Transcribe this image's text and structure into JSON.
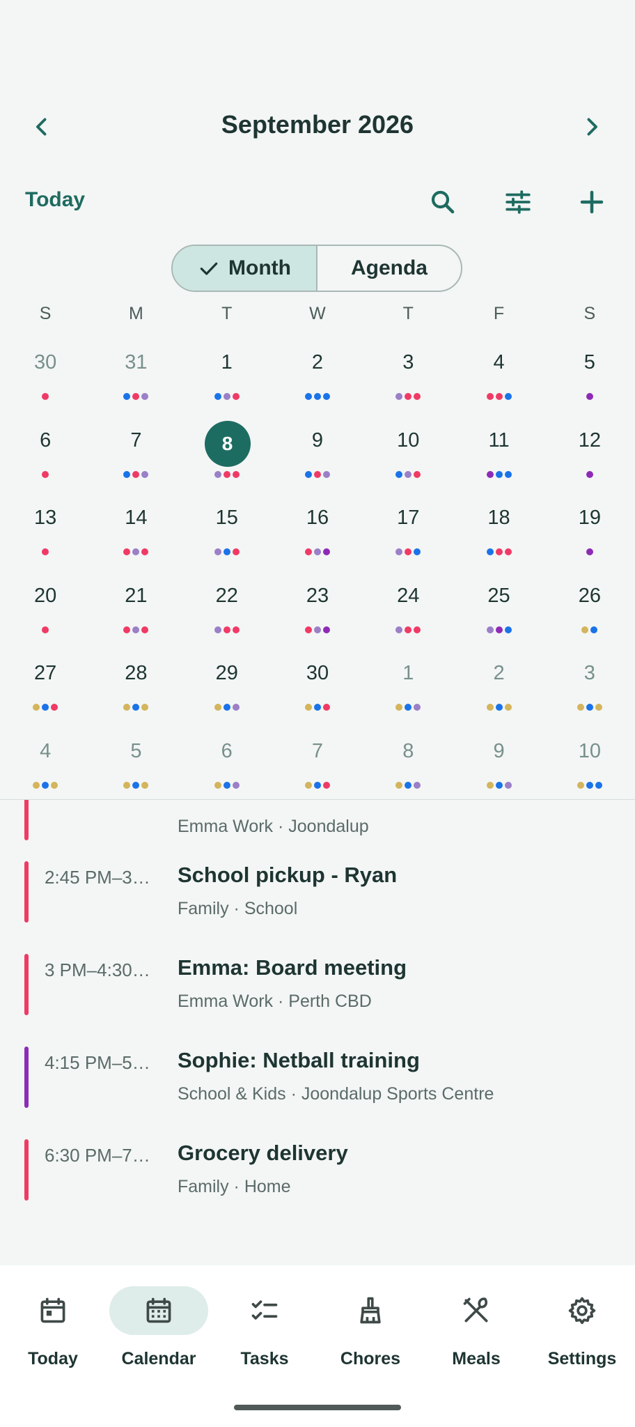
{
  "header": {
    "title": "September 2026",
    "prev_icon": "chevron-left-icon",
    "next_icon": "chevron-right-icon"
  },
  "toolbar": {
    "today_label": "Today",
    "icons": [
      "search-icon",
      "tune-icon",
      "add-icon"
    ]
  },
  "view_toggle": {
    "month_label": "Month",
    "agenda_label": "Agenda",
    "selected": "Month"
  },
  "weekdays": [
    "S",
    "M",
    "T",
    "W",
    "T",
    "F",
    "S"
  ],
  "colors": {
    "red": "#f03a66",
    "blue": "#1a73e8",
    "lavender": "#9b7fc7",
    "purple": "#8e2bb6",
    "gold": "#d4b45c",
    "accent": "#1d6c62"
  },
  "calendar": {
    "selected_day": "8",
    "weeks": [
      [
        {
          "d": "30",
          "o": true,
          "dots": [
            "red"
          ]
        },
        {
          "d": "31",
          "o": true,
          "dots": [
            "blue",
            "red",
            "lavender"
          ]
        },
        {
          "d": "1",
          "dots": [
            "blue",
            "lavender",
            "red"
          ]
        },
        {
          "d": "2",
          "dots": [
            "blue",
            "blue",
            "blue"
          ]
        },
        {
          "d": "3",
          "dots": [
            "lavender",
            "red",
            "red"
          ]
        },
        {
          "d": "4",
          "dots": [
            "red",
            "red",
            "blue"
          ]
        },
        {
          "d": "5",
          "dots": [
            "purple"
          ]
        }
      ],
      [
        {
          "d": "6",
          "dots": [
            "red"
          ]
        },
        {
          "d": "7",
          "dots": [
            "blue",
            "red",
            "lavender"
          ]
        },
        {
          "d": "8",
          "sel": true,
          "dots": [
            "lavender",
            "red",
            "red"
          ]
        },
        {
          "d": "9",
          "dots": [
            "blue",
            "red",
            "lavender"
          ]
        },
        {
          "d": "10",
          "dots": [
            "blue",
            "lavender",
            "red"
          ]
        },
        {
          "d": "11",
          "dots": [
            "purple",
            "blue",
            "blue"
          ]
        },
        {
          "d": "12",
          "dots": [
            "purple"
          ]
        }
      ],
      [
        {
          "d": "13",
          "dots": [
            "red"
          ]
        },
        {
          "d": "14",
          "dots": [
            "red",
            "lavender",
            "red"
          ]
        },
        {
          "d": "15",
          "dots": [
            "lavender",
            "blue",
            "red"
          ]
        },
        {
          "d": "16",
          "dots": [
            "red",
            "lavender",
            "purple"
          ]
        },
        {
          "d": "17",
          "dots": [
            "lavender",
            "red",
            "blue"
          ]
        },
        {
          "d": "18",
          "dots": [
            "blue",
            "red",
            "red"
          ]
        },
        {
          "d": "19",
          "dots": [
            "purple"
          ]
        }
      ],
      [
        {
          "d": "20",
          "dots": [
            "red"
          ]
        },
        {
          "d": "21",
          "dots": [
            "red",
            "lavender",
            "red"
          ]
        },
        {
          "d": "22",
          "dots": [
            "lavender",
            "red",
            "red"
          ]
        },
        {
          "d": "23",
          "dots": [
            "red",
            "lavender",
            "purple"
          ]
        },
        {
          "d": "24",
          "dots": [
            "lavender",
            "red",
            "red"
          ]
        },
        {
          "d": "25",
          "dots": [
            "lavender",
            "purple",
            "blue"
          ]
        },
        {
          "d": "26",
          "dots": [
            "gold",
            "blue"
          ]
        }
      ],
      [
        {
          "d": "27",
          "dots": [
            "gold",
            "blue",
            "red"
          ]
        },
        {
          "d": "28",
          "dots": [
            "gold",
            "blue",
            "gold"
          ]
        },
        {
          "d": "29",
          "dots": [
            "gold",
            "blue",
            "lavender"
          ]
        },
        {
          "d": "30",
          "dots": [
            "gold",
            "blue",
            "red"
          ]
        },
        {
          "d": "1",
          "o": true,
          "dots": [
            "gold",
            "blue",
            "lavender"
          ]
        },
        {
          "d": "2",
          "o": true,
          "dots": [
            "gold",
            "blue",
            "gold"
          ]
        },
        {
          "d": "3",
          "o": true,
          "dots": [
            "gold",
            "blue",
            "gold"
          ]
        }
      ],
      [
        {
          "d": "4",
          "o": true,
          "dots": [
            "gold",
            "blue",
            "gold"
          ]
        },
        {
          "d": "5",
          "o": true,
          "dots": [
            "gold",
            "blue",
            "gold"
          ]
        },
        {
          "d": "6",
          "o": true,
          "dots": [
            "gold",
            "blue",
            "lavender"
          ]
        },
        {
          "d": "7",
          "o": true,
          "dots": [
            "gold",
            "blue",
            "red"
          ]
        },
        {
          "d": "8",
          "o": true,
          "dots": [
            "gold",
            "blue",
            "lavender"
          ]
        },
        {
          "d": "9",
          "o": true,
          "dots": [
            "gold",
            "blue",
            "lavender"
          ]
        },
        {
          "d": "10",
          "o": true,
          "dots": [
            "gold",
            "blue",
            "blue"
          ]
        }
      ]
    ]
  },
  "events": [
    {
      "time": "",
      "title": "",
      "subtitle": "Emma Work · Joondalup",
      "color": "red"
    },
    {
      "time": "2:45 PM–3…",
      "title": "School pickup - Ryan",
      "subtitle": "Family · School",
      "color": "red"
    },
    {
      "time": "3 PM–4:30…",
      "title": "Emma: Board meeting",
      "subtitle": "Emma Work · Perth CBD",
      "color": "red"
    },
    {
      "time": "4:15 PM–5…",
      "title": "Sophie: Netball training",
      "subtitle": "School & Kids · Joondalup Sports Centre",
      "color": "purple"
    },
    {
      "time": "6:30 PM–7…",
      "title": "Grocery delivery",
      "subtitle": "Family · Home",
      "color": "red"
    }
  ],
  "bottom_nav": {
    "active": "Calendar",
    "items": [
      {
        "label": "Today",
        "icon": "today-icon"
      },
      {
        "label": "Calendar",
        "icon": "calendar-icon"
      },
      {
        "label": "Tasks",
        "icon": "tasks-icon"
      },
      {
        "label": "Chores",
        "icon": "broom-icon"
      },
      {
        "label": "Meals",
        "icon": "utensils-icon"
      },
      {
        "label": "Settings",
        "icon": "gear-icon"
      }
    ]
  }
}
